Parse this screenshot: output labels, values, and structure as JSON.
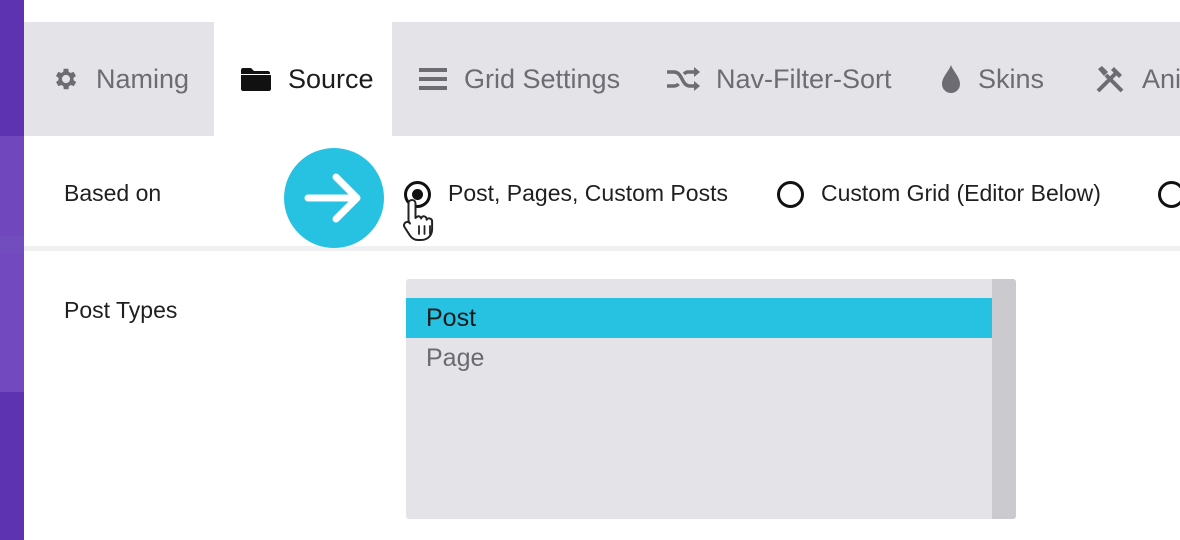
{
  "tabs": [
    {
      "label": "Naming",
      "icon": "gear-icon"
    },
    {
      "label": "Source",
      "icon": "folder-icon",
      "active": true
    },
    {
      "label": "Grid Settings",
      "icon": "menu-icon"
    },
    {
      "label": "Nav-Filter-Sort",
      "icon": "shuffle-icon"
    },
    {
      "label": "Skins",
      "icon": "drop-icon"
    },
    {
      "label": "Ani",
      "icon": "tools-icon"
    }
  ],
  "based_on": {
    "label": "Based on",
    "options": [
      {
        "label": "Post, Pages, Custom Posts",
        "selected": true
      },
      {
        "label": "Custom Grid (Editor Below)",
        "selected": false
      },
      {
        "label": "",
        "selected": false
      }
    ]
  },
  "post_types": {
    "label": "Post Types",
    "items": [
      {
        "label": "Post",
        "selected": true
      },
      {
        "label": "Page",
        "selected": false
      }
    ]
  },
  "colors": {
    "accent": "#27c2e2",
    "sidebar": "#5f35b4",
    "tabbar": "#e3e3e8"
  }
}
